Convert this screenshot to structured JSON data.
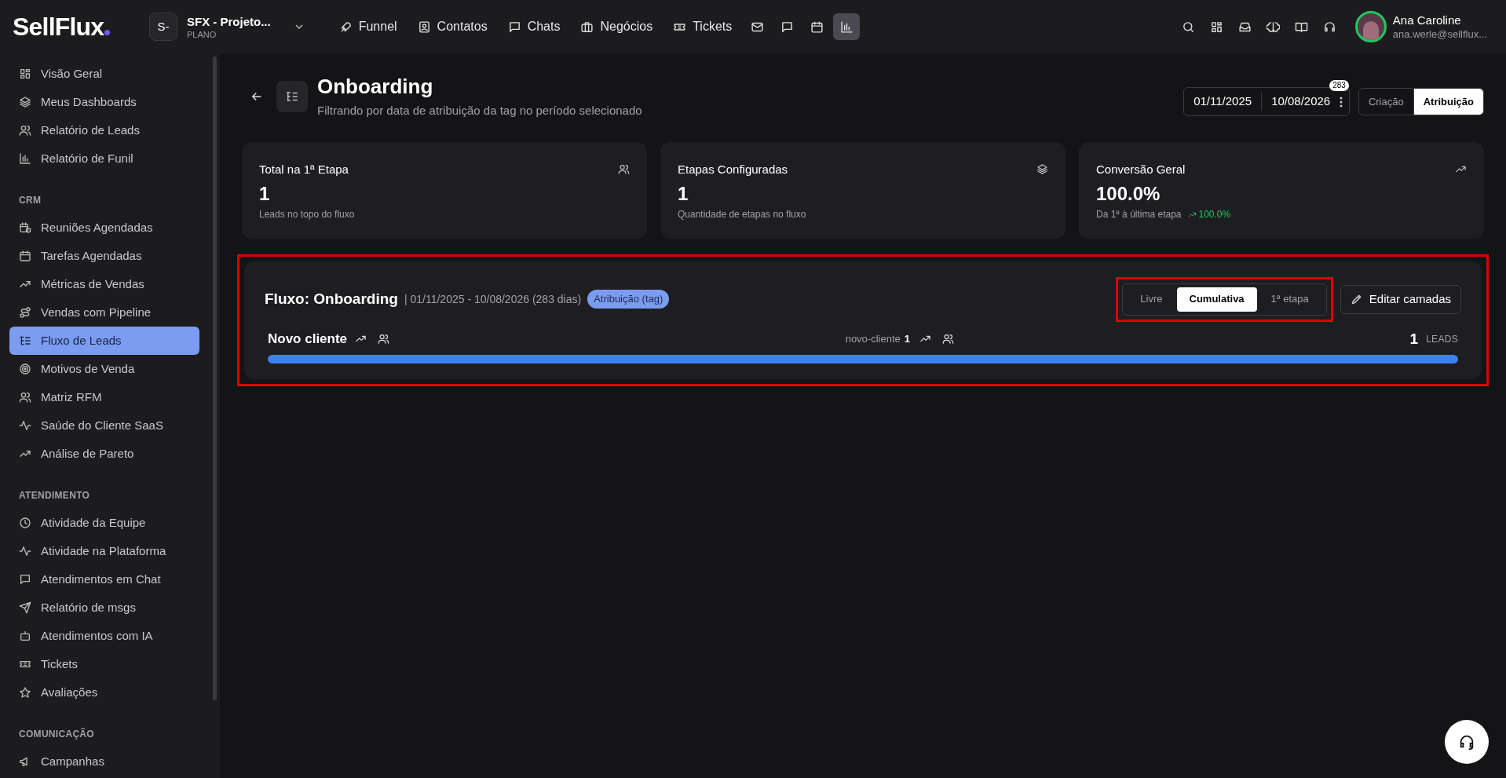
{
  "topbar": {
    "logo": "SellFlux",
    "workspace": {
      "avatar": "S-",
      "name": "SFX - Projeto...",
      "plan": "PLANO"
    },
    "nav": [
      {
        "label": "Funnel",
        "selected": false
      },
      {
        "label": "Contatos",
        "selected": false
      },
      {
        "label": "Chats",
        "selected": false
      },
      {
        "label": "Negócios",
        "selected": false
      },
      {
        "label": "Tickets",
        "selected": false
      }
    ],
    "icon_buttons": [
      {
        "selected": false
      },
      {
        "selected": false
      },
      {
        "selected": false
      },
      {
        "selected": true
      }
    ],
    "user": {
      "name": "Ana Caroline",
      "email": "ana.werle@sellflux..."
    }
  },
  "sidebar": {
    "sections": [
      {
        "items": [
          {
            "label": "Visão Geral",
            "selected": false
          },
          {
            "label": "Meus Dashboards",
            "selected": false
          },
          {
            "label": "Relatório de Leads",
            "selected": false
          },
          {
            "label": "Relatório de Funil",
            "selected": false
          }
        ]
      },
      {
        "title": "CRM",
        "items": [
          {
            "label": "Reuniões Agendadas",
            "selected": false
          },
          {
            "label": "Tarefas Agendadas",
            "selected": false
          },
          {
            "label": "Métricas de Vendas",
            "selected": false
          },
          {
            "label": "Vendas com Pipeline",
            "selected": false
          },
          {
            "label": "Fluxo de Leads",
            "selected": true
          },
          {
            "label": "Motivos de Venda",
            "selected": false
          },
          {
            "label": "Matriz RFM",
            "selected": false
          },
          {
            "label": "Saúde do Cliente SaaS",
            "selected": false
          },
          {
            "label": "Análise de Pareto",
            "selected": false
          }
        ]
      },
      {
        "title": "ATENDIMENTO",
        "items": [
          {
            "label": "Atividade da Equipe",
            "selected": false
          },
          {
            "label": "Atividade na Plataforma",
            "selected": false
          },
          {
            "label": "Atendimentos em Chat",
            "selected": false
          },
          {
            "label": "Relatório de msgs",
            "selected": false
          },
          {
            "label": "Atendimentos com IA",
            "selected": false
          },
          {
            "label": "Tickets",
            "selected": false
          },
          {
            "label": "Avaliações",
            "selected": false
          }
        ]
      },
      {
        "title": "COMUNICAÇÃO",
        "items": [
          {
            "label": "Campanhas",
            "selected": false
          }
        ]
      }
    ]
  },
  "header": {
    "title": "Onboarding",
    "subtitle": "Filtrando por data de atribuição da tag no período selecionado",
    "date_start": "01/11/2025",
    "date_end": "10/08/2026",
    "days_badge": "283",
    "mode_tabs": [
      {
        "label": "Criação",
        "selected": false
      },
      {
        "label": "Atribuição",
        "selected": true
      }
    ]
  },
  "stats": [
    {
      "title": "Total na 1ª Etapa",
      "value": "1",
      "caption": "Leads no topo do fluxo"
    },
    {
      "title": "Etapas Configuradas",
      "value": "1",
      "caption": "Quantidade de etapas no fluxo"
    },
    {
      "title": "Conversão Geral",
      "value": "100.0%",
      "caption": "Da 1ª à última etapa",
      "trend": "100.0%"
    }
  ],
  "flow": {
    "highlighted": true,
    "title": "Fluxo: Onboarding",
    "period": "| 01/11/2025 - 10/08/2026 (283 dias)",
    "badge": "Atribuição (tag)",
    "view_toggle": {
      "highlighted": true,
      "options": [
        {
          "label": "Livre",
          "selected": false
        },
        {
          "label": "Cumulativa",
          "selected": true
        },
        {
          "label": "1ª etapa",
          "selected": false
        }
      ]
    },
    "edit_button": "Editar camadas",
    "stages": [
      {
        "name": "Novo cliente",
        "tag": "novo-cliente",
        "tag_count": "1",
        "count": "1",
        "unit": "LEADS",
        "level": 1
      }
    ]
  }
}
